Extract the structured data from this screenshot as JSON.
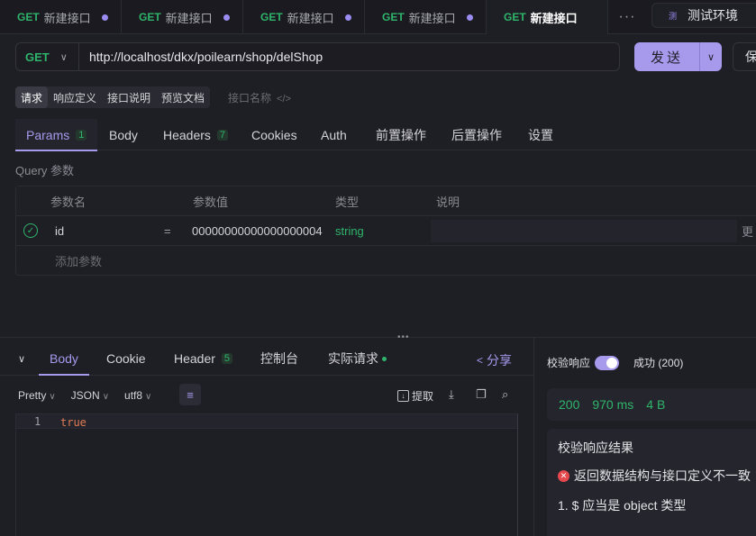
{
  "tabs": [
    {
      "method": "GET",
      "name": "新建接口",
      "active": false
    },
    {
      "method": "GET",
      "name": "新建接口",
      "active": false
    },
    {
      "method": "GET",
      "name": "新建接口",
      "active": false
    },
    {
      "method": "GET",
      "name": "新建接口",
      "active": false
    },
    {
      "method": "GET",
      "name": "新建接口",
      "active": true
    }
  ],
  "env": {
    "badge": "测",
    "label": "测试环境"
  },
  "request": {
    "method": "GET",
    "url": "http://localhost/dkx/poilearn/shop/delShop",
    "send_label": "发送",
    "save_label": "保"
  },
  "subtabs": [
    "请求",
    "响应定义",
    "接口说明",
    "预览文档"
  ],
  "api_name_placeholder": "接口名称",
  "param_tabs": {
    "params": "Params",
    "params_count": "1",
    "body": "Body",
    "headers": "Headers",
    "headers_count": "7",
    "cookies": "Cookies",
    "auth": "Auth",
    "pre": "前置操作",
    "post": "后置操作",
    "settings": "设置"
  },
  "query_label": "Query 参数",
  "param_table": {
    "headers": [
      "参数名",
      "参数值",
      "类型",
      "说明"
    ],
    "rows": [
      {
        "name": "id",
        "eq": "=",
        "value": "00000000000000000004",
        "type": "string",
        "more": "更"
      }
    ],
    "add_label": "添加参数"
  },
  "response_tabs": {
    "body": "Body",
    "cookie": "Cookie",
    "header": "Header",
    "header_count": "5",
    "console": "控制台",
    "actual": "实际请求",
    "share": "分享"
  },
  "format": {
    "pretty": "Pretty",
    "json": "JSON",
    "encoding": "utf8",
    "extract": "提取"
  },
  "editor": {
    "line_no": "1",
    "content": "true"
  },
  "validation": {
    "label": "校验响应",
    "toggle_on": true,
    "status": "成功 (200)",
    "code": "200",
    "time": "970 ms",
    "size": "4 B",
    "result_title": "校验响应结果",
    "error": "返回数据结构与接口定义不一致",
    "detail": "1. $ 应当是 object 类型"
  },
  "colors": {
    "accent": "#a799ec",
    "get": "#2fb56b",
    "error": "#e5484d",
    "bg": "#1e1e25"
  }
}
